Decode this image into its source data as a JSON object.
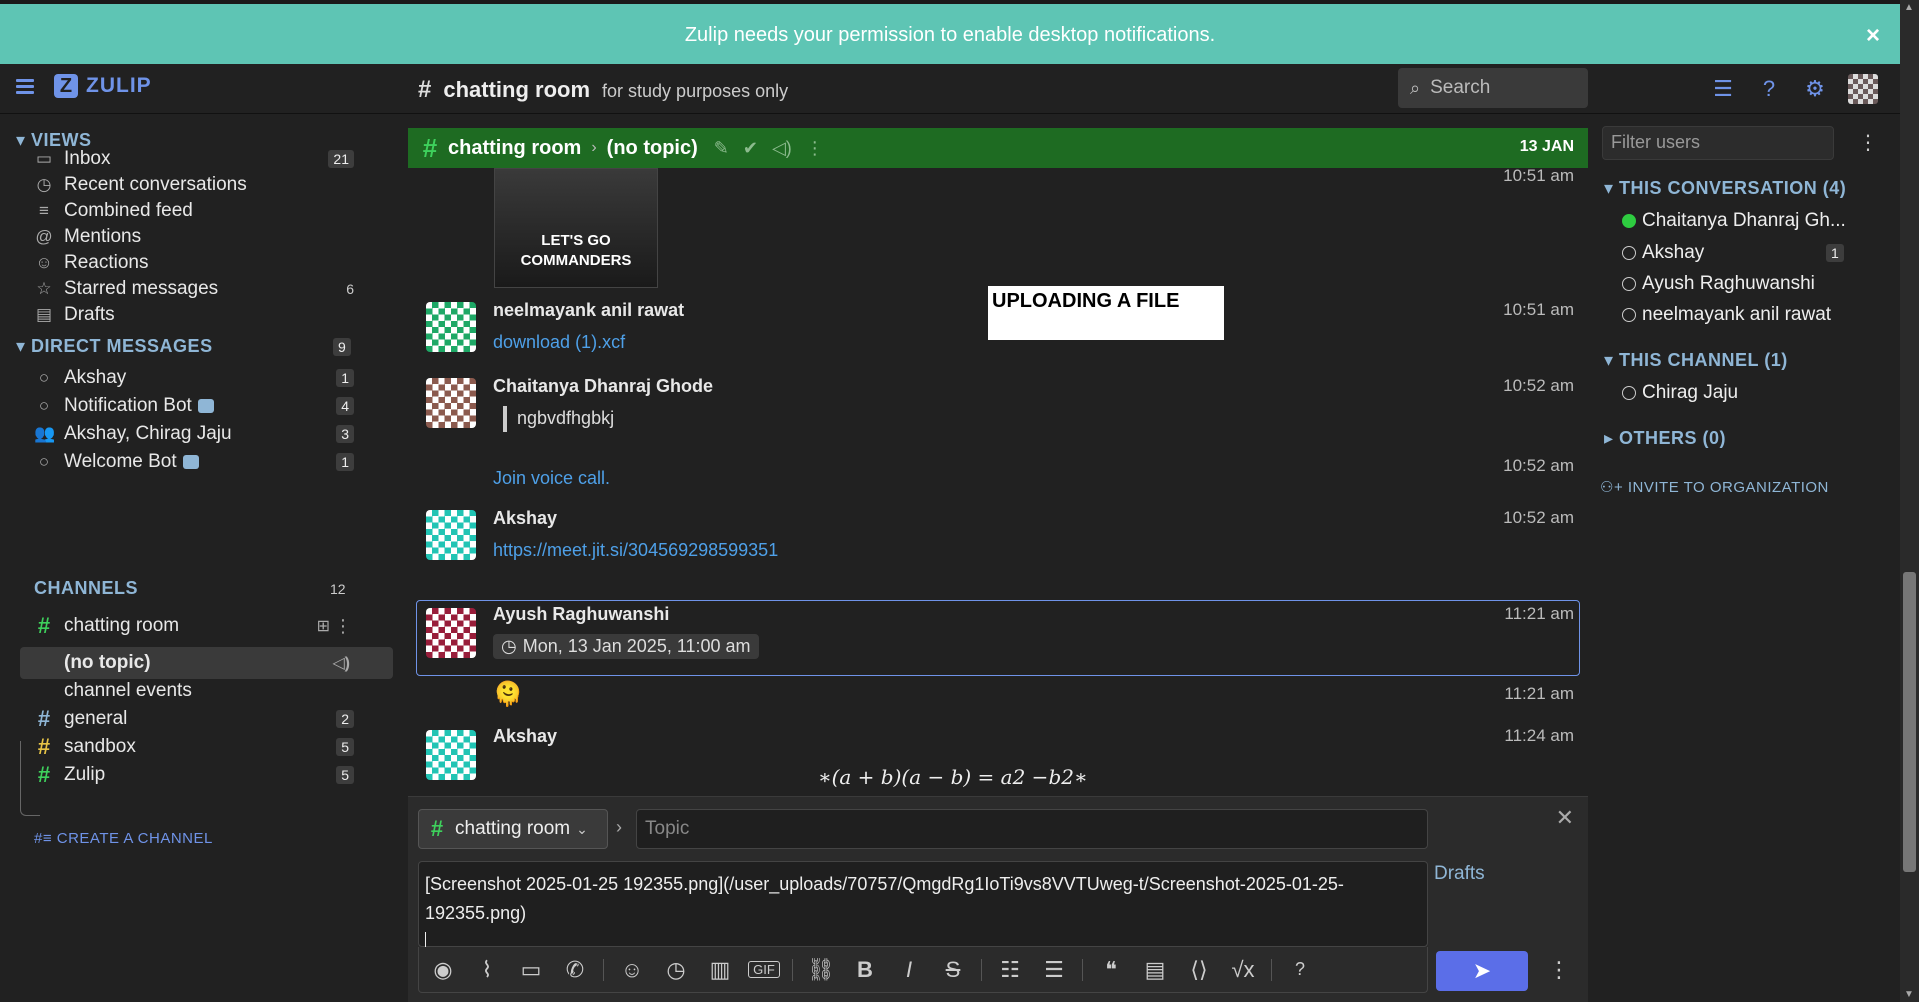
{
  "notification": {
    "text": "Zulip needs your permission to enable desktop notifications.",
    "close": "×"
  },
  "topnav": {
    "logo": "ZULIP",
    "channel": "chatting room",
    "description": "for study purposes only",
    "search_placeholder": "Search"
  },
  "sidebar": {
    "views_head": "VIEWS",
    "views": [
      {
        "label": "Inbox",
        "icon": "inbox-icon",
        "count": "21"
      },
      {
        "label": "Recent conversations",
        "icon": "clock-icon",
        "count": ""
      },
      {
        "label": "Combined feed",
        "icon": "feed-icon",
        "count": ""
      },
      {
        "label": "Mentions",
        "icon": "at-icon",
        "count": ""
      },
      {
        "label": "Reactions",
        "icon": "smile-icon",
        "count": ""
      },
      {
        "label": "Starred messages",
        "icon": "star-icon",
        "count": "6"
      },
      {
        "label": "Drafts",
        "icon": "drafts-icon",
        "count": ""
      }
    ],
    "dm_head": "DIRECT MESSAGES",
    "dm_count": "9",
    "dms": [
      {
        "label": "Akshay",
        "count": "1"
      },
      {
        "label": "Notification Bot",
        "count": "4"
      },
      {
        "label": "Akshay, Chirag Jaju",
        "count": "3"
      },
      {
        "label": "Welcome Bot",
        "count": "1"
      }
    ],
    "channels_head": "CHANNELS",
    "channels_count": "12",
    "channels": [
      {
        "label": "chatting room",
        "color": "#3ed15c"
      },
      {
        "label": "(no topic)"
      },
      {
        "label": "channel events"
      },
      {
        "label": "general",
        "count": "2",
        "color": "#8fb6d6"
      },
      {
        "label": "sandbox",
        "count": "5",
        "color": "#e8c547"
      },
      {
        "label": "Zulip",
        "count": "5",
        "color": "#3ed15c"
      }
    ],
    "create_channel": "CREATE A CHANNEL"
  },
  "recipient_bar": {
    "channel": "chatting room",
    "topic": "(no topic)",
    "date": "13 JAN"
  },
  "messages": {
    "first_time": "10:51 am",
    "image_caption": "LET'S GO COMMANDERS",
    "upload_label": "UPLOADING A FILE",
    "m1": {
      "sender": "neelmayank anil rawat",
      "time": "10:51 am",
      "body": "download (1).xcf"
    },
    "m2": {
      "sender": "Chaitanya Dhanraj Ghode",
      "time": "10:52 am",
      "body": "ngbvdfhgbkj"
    },
    "m3": {
      "time": "10:52 am",
      "body": "Join voice call."
    },
    "m4": {
      "sender": "Akshay",
      "time": "10:52 am",
      "body": "https://meet.jit.si/304569298599351"
    },
    "m5": {
      "sender": "Ayush Raghuwanshi",
      "time": "11:21 am",
      "body": "Mon, 13 Jan 2025, 11:00 am"
    },
    "m6": {
      "time": "11:21 am",
      "body": "🫠"
    },
    "m7": {
      "sender": "Akshay",
      "time": "11:24 am",
      "body": "∗(a + b)(a − b) = a2 −b2∗"
    }
  },
  "right_sidebar": {
    "filter_placeholder": "Filter users",
    "this_conversation": "THIS CONVERSATION (4)",
    "conversation_users": [
      {
        "name": "Chaitanya Dhanraj Gh...",
        "online": true,
        "count": ""
      },
      {
        "name": "Akshay",
        "online": false,
        "count": "1"
      },
      {
        "name": "Ayush Raghuwanshi",
        "online": false,
        "count": ""
      },
      {
        "name": "neelmayank anil rawat",
        "online": false,
        "count": ""
      }
    ],
    "this_channel": "THIS CHANNEL (1)",
    "channel_users": [
      {
        "name": "Chirag Jaju"
      }
    ],
    "others": "OTHERS (0)",
    "invite": "INVITE TO ORGANIZATION"
  },
  "compose": {
    "stream": "chatting room",
    "topic_placeholder": "Topic",
    "text": "[Screenshot 2025-01-25 192355.png](/user_uploads/70757/QmgdRg1IoTi9vs8VVTUweg-t/Screenshot-2025-01-25-192355.png)",
    "drafts": "Drafts"
  }
}
